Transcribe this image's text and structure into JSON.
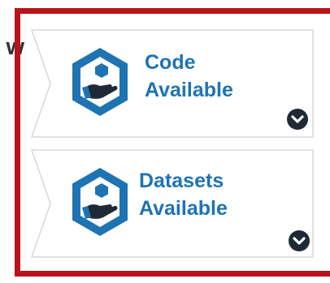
{
  "partial_heading": "w",
  "colors": {
    "frame": "#b8141b",
    "accent": "#1e73b3",
    "icon_dark": "#1f2a36"
  },
  "badges": [
    {
      "label_line1": "Code",
      "label_line2": "Available",
      "icon": "hand-hexagon-icon",
      "toggle_icon": "chevron-down-icon"
    },
    {
      "label_line1": "Datasets",
      "label_line2": "Available",
      "icon": "hand-hexagon-icon",
      "toggle_icon": "chevron-down-icon"
    }
  ]
}
